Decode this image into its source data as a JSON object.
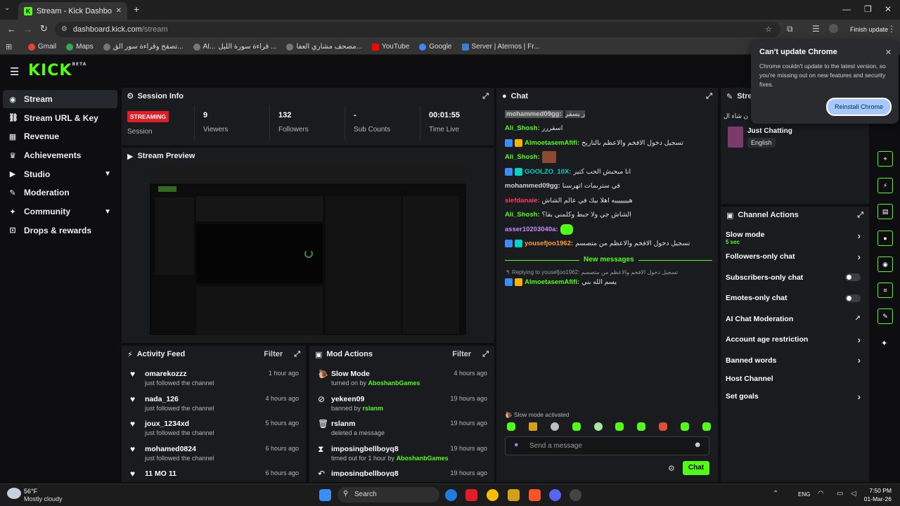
{
  "browser": {
    "tab_title": "Stream - Kick Dashboard",
    "url_domain": "dashboard.kick.com",
    "url_path": "/stream",
    "finish_update": "Finish update",
    "bookmarks": [
      "Gmail",
      "Maps",
      "تصفح وقراءة سور الق...",
      "AI...",
      "قراءة سورة الليل ...",
      "مصحف مشاري العفا...",
      "YouTube",
      "Google",
      "Server | Aternos | Fr..."
    ]
  },
  "popup": {
    "title": "Can't update Chrome",
    "body": "Chrome couldn't update to the latest version, so you're missing out on new features and security fixes.",
    "button": "Reinstall Chrome"
  },
  "brand": {
    "logo": "KICK",
    "beta": "BETA",
    "accent": "#53fc18"
  },
  "sidebar": {
    "items": [
      {
        "label": "Stream"
      },
      {
        "label": "Stream URL & Key"
      },
      {
        "label": "Revenue"
      },
      {
        "label": "Achievements"
      },
      {
        "label": "Studio"
      },
      {
        "label": "Moderation"
      },
      {
        "label": "Community"
      },
      {
        "label": "Drops & rewards"
      }
    ]
  },
  "session": {
    "title": "Session Info",
    "status": "STREAMING",
    "session_label": "Session",
    "viewers": "9",
    "viewers_label": "Viewers",
    "followers": "132",
    "followers_label": "Followers",
    "subs": "-",
    "subs_label": "Sub Counts",
    "time": "00:01:55",
    "time_label": "Time Live"
  },
  "preview": {
    "title": "Stream Preview"
  },
  "activity": {
    "title": "Activity Feed",
    "filter": "Filter",
    "rows": [
      {
        "name": "omarekozzz",
        "sub": "just followed the channel",
        "time": "1 hour ago"
      },
      {
        "name": "nada_126",
        "sub": "just followed the channel",
        "time": "4 hours ago"
      },
      {
        "name": "joux_1234xd",
        "sub": "just followed the channel",
        "time": "5 hours ago"
      },
      {
        "name": "mohamed0824",
        "sub": "just followed the channel",
        "time": "6 hours ago"
      },
      {
        "name": "11 MO 11",
        "sub": "",
        "time": "6 hours ago"
      }
    ]
  },
  "mod": {
    "title": "Mod Actions",
    "filter": "Filter",
    "rows": [
      {
        "name": "Slow Mode",
        "pre": "turned on by ",
        "who": "AboshanbGames",
        "time": "4 hours ago"
      },
      {
        "name": "yekeen09",
        "pre": "banned by ",
        "who": "rslanm",
        "time": "19 hours ago"
      },
      {
        "name": "rslanm",
        "pre": "deleted a message",
        "who": "",
        "time": "19 hours ago"
      },
      {
        "name": "imposingbellboyq8",
        "pre": "timed out for 1 hour by ",
        "who": "AboshanbGames",
        "time": "19 hours ago"
      },
      {
        "name": "imposingbellboyq8",
        "pre": "",
        "who": "",
        "time": "19 hours ago"
      }
    ]
  },
  "chat": {
    "title": "Chat",
    "messages": [
      {
        "user": "mohammed09gg:",
        "text": "ر يسقر",
        "color": "#9a9a9a"
      },
      {
        "user": "Ali_Shosh:",
        "text": "اسقررر",
        "color": "#53fc18"
      },
      {
        "user": "AlmoetasemAfifi:",
        "text": "تسجيل دخول الافخم والاعظم بالتاريخ",
        "color": "#53fc18"
      },
      {
        "user": "Ali_Shosh:",
        "text": "",
        "color": "#53fc18"
      },
      {
        "user": "GOOLZO_10X:",
        "text": "انا مبحبش الحب كتير",
        "color": "#00d4c8"
      },
      {
        "user": "mohammed09gg:",
        "text": "في سترىمات اتهرسنا",
        "color": "#d0d0d0"
      },
      {
        "user": "siefdanaie:",
        "text": "هيييييييه اهلا بيك في عالم الشاش",
        "color": "#ff3b5c"
      },
      {
        "user": "Ali_Shosh:",
        "text": "الشاش جي ولا حبط وكلمني بقا؟",
        "color": "#53fc18"
      },
      {
        "user": "asser10203040a:",
        "text": "",
        "color": "#c98bff"
      },
      {
        "user": "yousefjoo1962:",
        "text": "تسجيل دخول الافخم والاعظم من متصسم",
        "color": "#ff9f2e"
      }
    ],
    "new_messages": "New messages",
    "reply_to": "Replying to yousefjoo1962: تسجيل دخول الافخم والاعظم من متصسم",
    "reply": {
      "user": "AlmoetasemAfifi:",
      "text": "يسم الله بني",
      "color": "#53fc18"
    },
    "slow_mode": "Slow mode activated",
    "placeholder": "Send a message",
    "send": "Chat"
  },
  "stream_info": {
    "title": "Strea",
    "category": "Just Chatting",
    "language": "English",
    "arabic": "ن شاء ال"
  },
  "channel_actions": {
    "title": "Channel Actions",
    "items": [
      {
        "label": "Slow mode",
        "sub": "5 sec",
        "ctl": "chevron"
      },
      {
        "label": "Followers-only chat",
        "ctl": "chevron"
      },
      {
        "label": "Subscribers-only chat",
        "ctl": "toggle"
      },
      {
        "label": "Emotes-only chat",
        "ctl": "toggle"
      },
      {
        "label": "AI Chat Moderation",
        "ctl": "external"
      },
      {
        "label": "Account age restriction",
        "ctl": "chevron"
      },
      {
        "label": "Banned words",
        "ctl": "chevron"
      },
      {
        "label": "Host Channel",
        "ctl": "none"
      },
      {
        "label": "Set goals",
        "ctl": "chevron"
      }
    ]
  },
  "taskbar": {
    "temp": "56°F",
    "weather": "Mostly cloudy",
    "search": "Search",
    "lang": "ENG",
    "time": "7:50 PM",
    "date": "01-Mar-26"
  }
}
